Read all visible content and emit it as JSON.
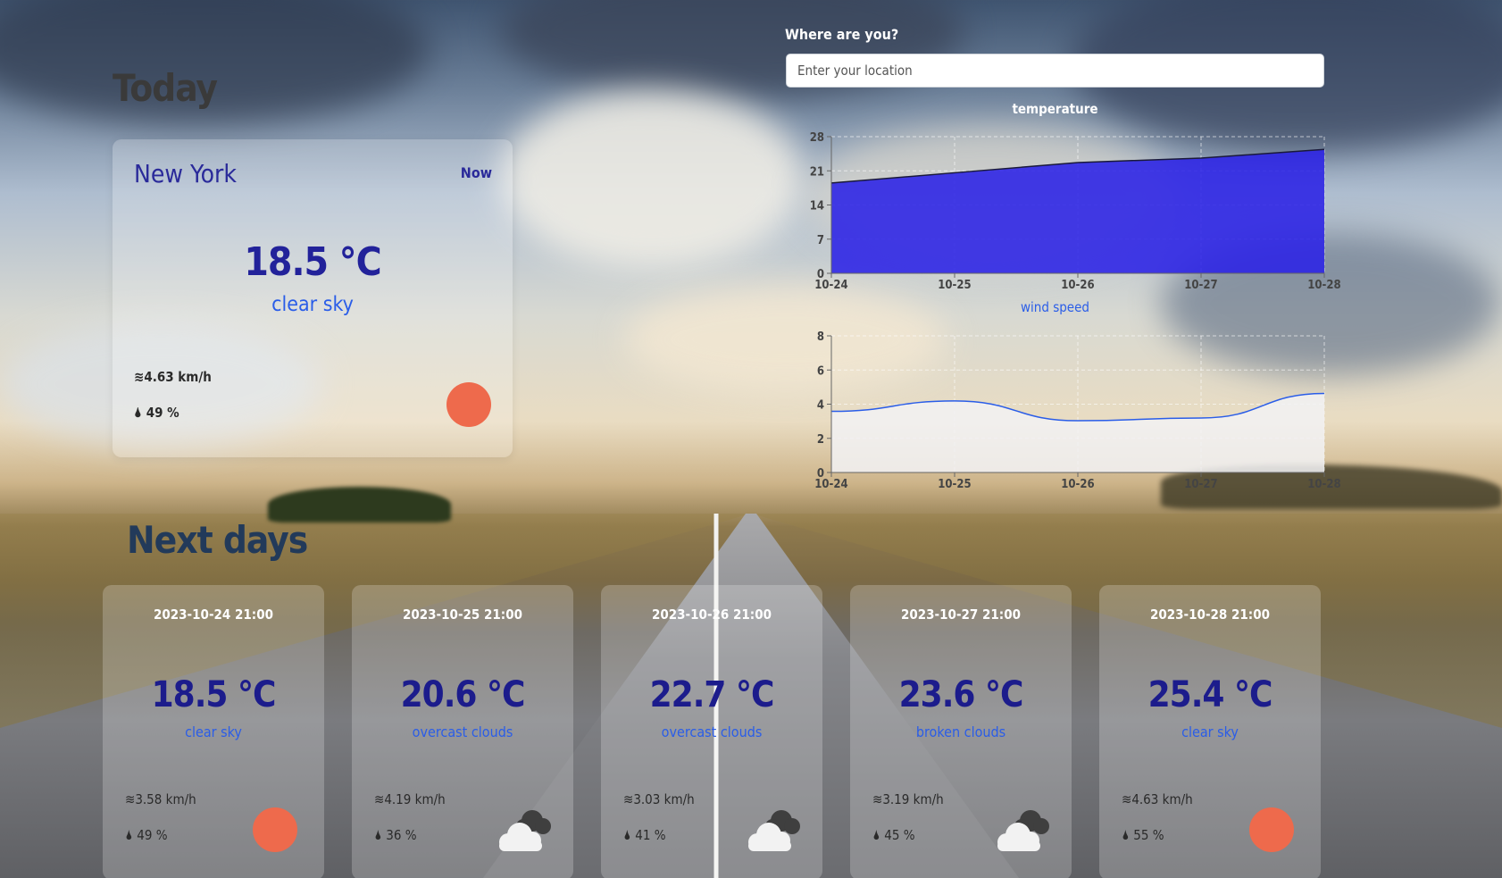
{
  "headings": {
    "today": "Today",
    "next_days": "Next days"
  },
  "current": {
    "city": "New York",
    "when": "Now",
    "temperature": "18.5 °C",
    "description": "clear sky",
    "wind": "4.63 km/h",
    "humidity": "49 %",
    "icon": "sun-icon"
  },
  "location": {
    "label": "Where are you?",
    "placeholder": "Enter your location",
    "value": ""
  },
  "chart_data": [
    {
      "type": "area",
      "title": "temperature",
      "x": [
        "10-24",
        "10-25",
        "10-26",
        "10-27",
        "10-28"
      ],
      "series": [
        {
          "values": [
            18.5,
            20.6,
            22.7,
            23.6,
            25.4
          ]
        }
      ],
      "ylim": [
        0,
        28
      ],
      "yticks": [
        "0",
        "7",
        "14",
        "21",
        "28"
      ],
      "grid": true,
      "fill_color": "#2b22e6",
      "title_color": "#ffffff"
    },
    {
      "type": "area",
      "title": "wind speed",
      "x": [
        "10-24",
        "10-25",
        "10-26",
        "10-27",
        "10-28"
      ],
      "series": [
        {
          "values": [
            3.58,
            4.19,
            3.03,
            3.19,
            4.63
          ]
        }
      ],
      "ylim": [
        0,
        8
      ],
      "yticks": [
        "0",
        "2",
        "4",
        "6",
        "8"
      ],
      "grid": true,
      "fill_color": "#f2f2f4",
      "line_color": "#2a5de8",
      "title_color": "#2a5de8"
    }
  ],
  "forecast": [
    {
      "date": "2023-10-24 21:00",
      "temperature": "18.5 °C",
      "description": "clear sky",
      "wind": "3.58 km/h",
      "humidity": "49 %",
      "icon": "sun-icon"
    },
    {
      "date": "2023-10-25 21:00",
      "temperature": "20.6 °C",
      "description": "overcast clouds",
      "wind": "4.19 km/h",
      "humidity": "36 %",
      "icon": "clouds-icon"
    },
    {
      "date": "2023-10-26 21:00",
      "temperature": "22.7 °C",
      "description": "overcast clouds",
      "wind": "3.03 km/h",
      "humidity": "41 %",
      "icon": "clouds-icon"
    },
    {
      "date": "2023-10-27 21:00",
      "temperature": "23.6 °C",
      "description": "broken clouds",
      "wind": "3.19 km/h",
      "humidity": "45 %",
      "icon": "clouds-icon"
    },
    {
      "date": "2023-10-28 21:00",
      "temperature": "25.4 °C",
      "description": "clear sky",
      "wind": "4.63 km/h",
      "humidity": "55 %",
      "icon": "sun-icon"
    }
  ],
  "icons": {
    "wind": "wind-icon",
    "humidity": "droplet-icon"
  },
  "colors": {
    "accent": "#2a5de8",
    "temperature_text": "#1c1c8c",
    "sun": "#ee6a4c"
  }
}
